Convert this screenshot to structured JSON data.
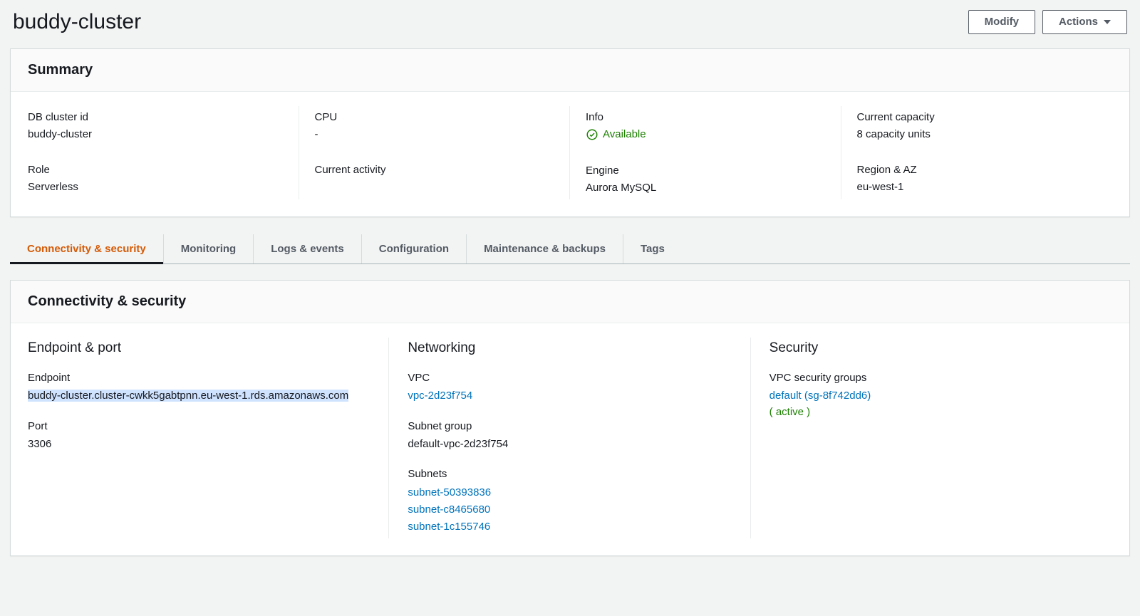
{
  "header": {
    "title": "buddy-cluster",
    "modify_label": "Modify",
    "actions_label": "Actions"
  },
  "summary": {
    "heading": "Summary",
    "cols": [
      [
        {
          "label": "DB cluster id",
          "value": "buddy-cluster"
        },
        {
          "label": "Role",
          "value": "Serverless"
        }
      ],
      [
        {
          "label": "CPU",
          "value": "-"
        },
        {
          "label": "Current activity",
          "value": ""
        }
      ],
      [
        {
          "label": "Info",
          "value": "Available",
          "status": "ok"
        },
        {
          "label": "Engine",
          "value": "Aurora MySQL"
        }
      ],
      [
        {
          "label": "Current capacity",
          "value": "8 capacity units"
        },
        {
          "label": "Region & AZ",
          "value": "eu-west-1"
        }
      ]
    ]
  },
  "tabs": [
    "Connectivity & security",
    "Monitoring",
    "Logs & events",
    "Configuration",
    "Maintenance & backups",
    "Tags"
  ],
  "connectivity": {
    "heading": "Connectivity & security",
    "endpoint_section": {
      "heading": "Endpoint & port",
      "endpoint_label": "Endpoint",
      "endpoint_value": "buddy-cluster.cluster-cwkk5gabtpnn.eu-west-1.rds.amazonaws.com",
      "port_label": "Port",
      "port_value": "3306"
    },
    "networking_section": {
      "heading": "Networking",
      "vpc_label": "VPC",
      "vpc_value": "vpc-2d23f754",
      "subnet_group_label": "Subnet group",
      "subnet_group_value": "default-vpc-2d23f754",
      "subnets_label": "Subnets",
      "subnets": [
        "subnet-50393836",
        "subnet-c8465680",
        "subnet-1c155746"
      ]
    },
    "security_section": {
      "heading": "Security",
      "vpc_sg_label": "VPC security groups",
      "sg_link": "default (sg-8f742dd6)",
      "sg_status": "( active )"
    }
  }
}
